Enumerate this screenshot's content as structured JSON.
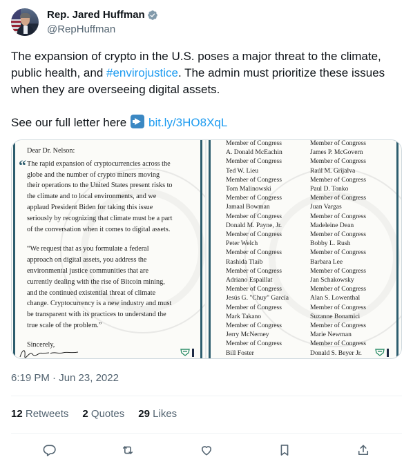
{
  "author": {
    "display_name": "Rep. Jared Huffman",
    "handle": "@RepHuffman",
    "verified_icon": "verified-badge-icon"
  },
  "tweet": {
    "line1": "The expansion of crypto in the U.S. poses a major threat to the climate,",
    "line2_pre": "public health, and ",
    "hashtag": "#envirojustice",
    "line2_post": ". The admin must prioritize these issues",
    "line3": "when they are overseeing digital assets.",
    "line4_pre": "See our full letter here ",
    "arrow_emoji": "right-arrow-emoji-icon",
    "link": "bit.ly/3HO8XqL"
  },
  "media": {
    "letter": {
      "salutation": "Dear Dr. Nelson:",
      "paragraph1": [
        "The rapid expansion of cryptocurrencies across the",
        "globe and the number of crypto miners moving",
        "their operations to the United States present risks to",
        "the climate and to local environments, and we",
        "applaud President Biden for taking this issue",
        "seriously by recognizing that climate must be a part",
        "of the conversation when it comes to digital assets."
      ],
      "paragraph2": [
        "“We request that as you formulate a federal",
        "approach on digital assets, you address the",
        "environmental justice communities that are",
        "currently dealing with the rise of Bitcoin mining,",
        "and the continued existential threat of climate",
        "change. Cryptocurrency is a new industry and must",
        "be transparent with its practices to understand the",
        "true scale of the problem.”"
      ],
      "closing": "Sincerely,"
    },
    "signatories_left": [
      {
        "name": "",
        "title": "Member of Congress"
      },
      {
        "name": "A. Donald McEachin",
        "title": "Member of Congress"
      },
      {
        "name": "Ted W. Lieu",
        "title": "Member of Congress"
      },
      {
        "name": "Tom Malinowski",
        "title": "Member of Congress"
      },
      {
        "name": "Jamaal Bowman",
        "title": "Member of Congress"
      },
      {
        "name": "Donald M. Payne, Jr.",
        "title": "Member of Congress"
      },
      {
        "name": "Peter Welch",
        "title": "Member of Congress"
      },
      {
        "name": "Rashida Tlaib",
        "title": "Member of Congress"
      },
      {
        "name": "Adriano Espaillat",
        "title": "Member of Congress"
      },
      {
        "name": "Jesús G. \"Chuy\" García",
        "title": "Member of Congress"
      },
      {
        "name": "Mark Takano",
        "title": "Member of Congress"
      },
      {
        "name": "Jerry McNerney",
        "title": "Member of Congress"
      },
      {
        "name": "Bill Foster",
        "title": "Member of Congress"
      }
    ],
    "signatories_right": [
      {
        "name": "",
        "title": "Member of Congress"
      },
      {
        "name": "James P. McGovern",
        "title": "Member of Congress"
      },
      {
        "name": "Raúl M. Grijalva",
        "title": "Member of Congress"
      },
      {
        "name": "Paul D. Tonko",
        "title": "Member of Congress"
      },
      {
        "name": "Juan Vargas",
        "title": "Member of Congress"
      },
      {
        "name": "Madeleine Dean",
        "title": "Member of Congress"
      },
      {
        "name": "Bobby L. Rush",
        "title": "Member of Congress"
      },
      {
        "name": "Barbara Lee",
        "title": "Member of Congress"
      },
      {
        "name": "Jan Schakowsky",
        "title": "Member of Congress"
      },
      {
        "name": "Alan S. Lowenthal",
        "title": "Member of Congress"
      },
      {
        "name": "Suzanne Bonamici",
        "title": "Member of Congress"
      },
      {
        "name": "Marie Newman",
        "title": "Member of Congress"
      },
      {
        "name": "Donald S. Beyer Jr.",
        "title": "Member of Congress"
      }
    ]
  },
  "timestamp": "6:19 PM · Jun 23, 2022",
  "stats": {
    "retweets_count": "12",
    "retweets_label": "Retweets",
    "quotes_count": "2",
    "quotes_label": "Quotes",
    "likes_count": "29",
    "likes_label": "Likes"
  },
  "actions": [
    "reply-icon",
    "retweet-icon",
    "like-icon",
    "bookmark-icon",
    "share-icon"
  ],
  "colors": {
    "link": "#1d9bf0",
    "secondary_text": "#536471",
    "border": "#cfd9de",
    "letter_accent": "#2d5d6e"
  }
}
